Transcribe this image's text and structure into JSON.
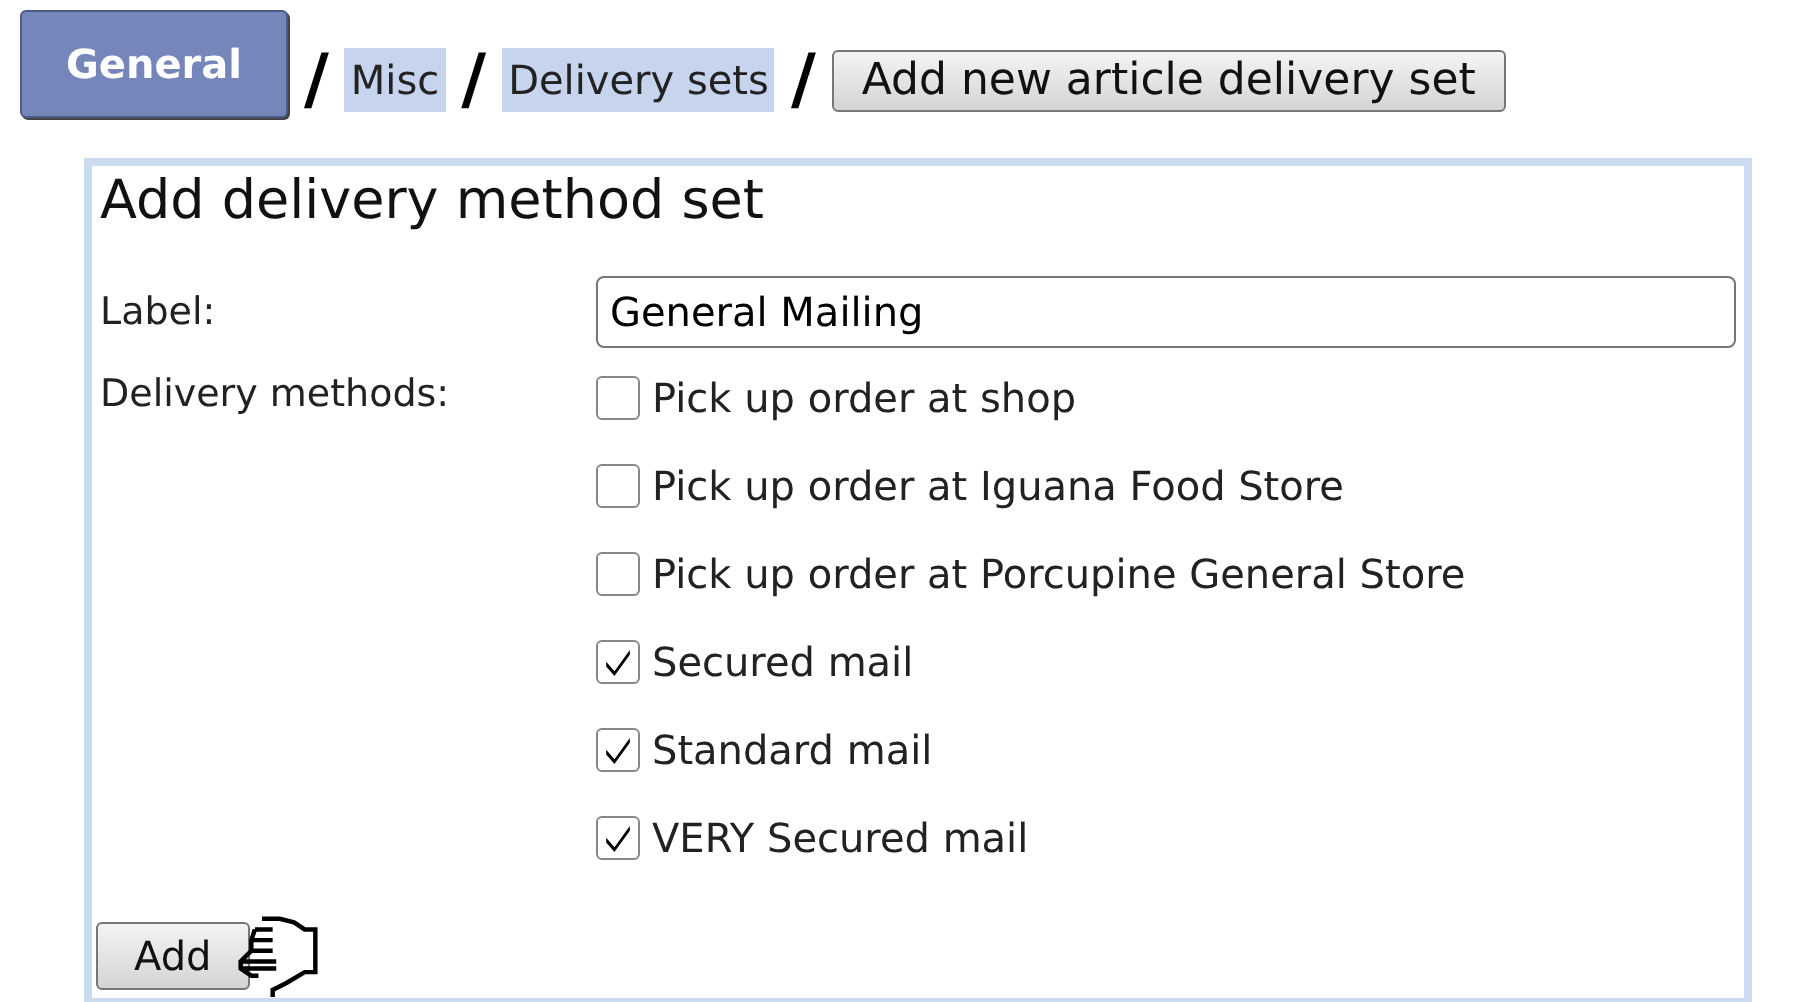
{
  "breadcrumb": [
    {
      "kind": "tab",
      "label": "General"
    },
    {
      "kind": "separator",
      "label": "/"
    },
    {
      "kind": "link",
      "label": "Misc"
    },
    {
      "kind": "separator",
      "label": "/"
    },
    {
      "kind": "link",
      "label": "Delivery sets"
    },
    {
      "kind": "separator",
      "label": "/"
    },
    {
      "kind": "button",
      "label": "Add new article delivery set"
    }
  ],
  "form": {
    "title": "Add delivery method set",
    "label_field": {
      "label": "Label:",
      "value": "General Mailing"
    },
    "methods_label": "Delivery methods:",
    "methods": [
      {
        "label": "Pick up order at shop",
        "checked": false
      },
      {
        "label": "Pick up order at Iguana Food Store",
        "checked": false
      },
      {
        "label": "Pick up order at Porcupine General Store",
        "checked": false
      },
      {
        "label": "Secured mail",
        "checked": true
      },
      {
        "label": "Standard mail",
        "checked": true
      },
      {
        "label": "VERY Secured mail",
        "checked": true
      }
    ],
    "submit": "Add"
  }
}
